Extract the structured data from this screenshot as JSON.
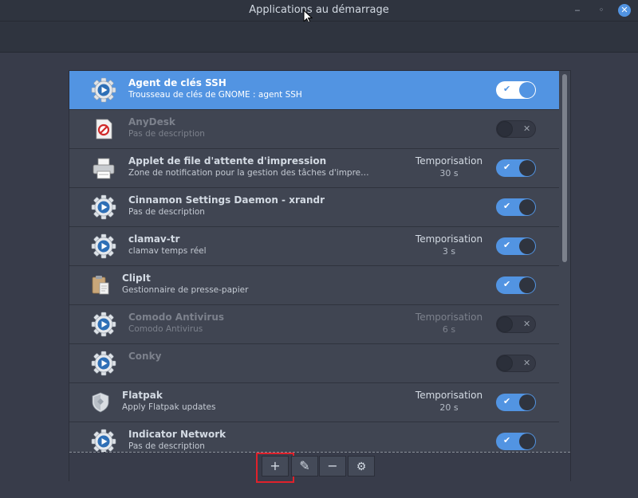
{
  "window": {
    "title": "Applications au démarrage",
    "buttons": [
      "minimize-icon",
      "maximize-icon",
      "close-icon"
    ]
  },
  "list": {
    "items": [
      {
        "name": "Agent de clés SSH",
        "description": "Trousseau de clés de GNOME : agent SSH",
        "icon": "gear-play-icon",
        "delay_label": "",
        "delay_value": "",
        "enabled": true,
        "selected": true
      },
      {
        "name": "AnyDesk",
        "description": "Pas de description",
        "icon": "anydesk-icon",
        "delay_label": "",
        "delay_value": "",
        "enabled": false,
        "selected": false
      },
      {
        "name": "Applet de file d'attente d'impression",
        "description": "Zone de notification pour la gestion des tâches d'impre…",
        "icon": "printer-icon",
        "delay_label": "Temporisation",
        "delay_value": "30 s",
        "enabled": true,
        "selected": false
      },
      {
        "name": "Cinnamon Settings Daemon - xrandr",
        "description": "Pas de description",
        "icon": "gear-play-icon",
        "delay_label": "",
        "delay_value": "",
        "enabled": true,
        "selected": false
      },
      {
        "name": "clamav-tr",
        "description": "clamav temps réel",
        "icon": "gear-play-icon",
        "delay_label": "Temporisation",
        "delay_value": "3 s",
        "enabled": true,
        "selected": false
      },
      {
        "name": "ClipIt",
        "description": "Gestionnaire de presse-papier",
        "icon": "clipboard-icon",
        "delay_label": "",
        "delay_value": "",
        "enabled": true,
        "selected": false
      },
      {
        "name": "Comodo Antivirus",
        "description": "Comodo Antivirus",
        "icon": "gear-play-icon",
        "delay_label": "Temporisation",
        "delay_value": "6 s",
        "enabled": false,
        "selected": false
      },
      {
        "name": "Conky",
        "description": "",
        "icon": "gear-play-icon",
        "delay_label": "",
        "delay_value": "",
        "enabled": false,
        "selected": false
      },
      {
        "name": "Flatpak",
        "description": "Apply Flatpak updates",
        "icon": "shield-icon",
        "delay_label": "Temporisation",
        "delay_value": "20 s",
        "enabled": true,
        "selected": false
      },
      {
        "name": "Indicator Network",
        "description": "Pas de description",
        "icon": "gear-play-icon",
        "delay_label": "",
        "delay_value": "",
        "enabled": true,
        "selected": false
      }
    ]
  },
  "actions": [
    {
      "name": "add-button",
      "icon": "plus-icon",
      "label": "+"
    },
    {
      "name": "edit-button",
      "icon": "pencil-icon",
      "label": "✎"
    },
    {
      "name": "remove-button",
      "icon": "minus-icon",
      "label": "−"
    },
    {
      "name": "run-now-button",
      "icon": "gears-icon",
      "label": "⚙"
    }
  ],
  "colors": {
    "accent": "#5294e2",
    "background": "#383c4a",
    "highlight_box": "#e0212b"
  }
}
